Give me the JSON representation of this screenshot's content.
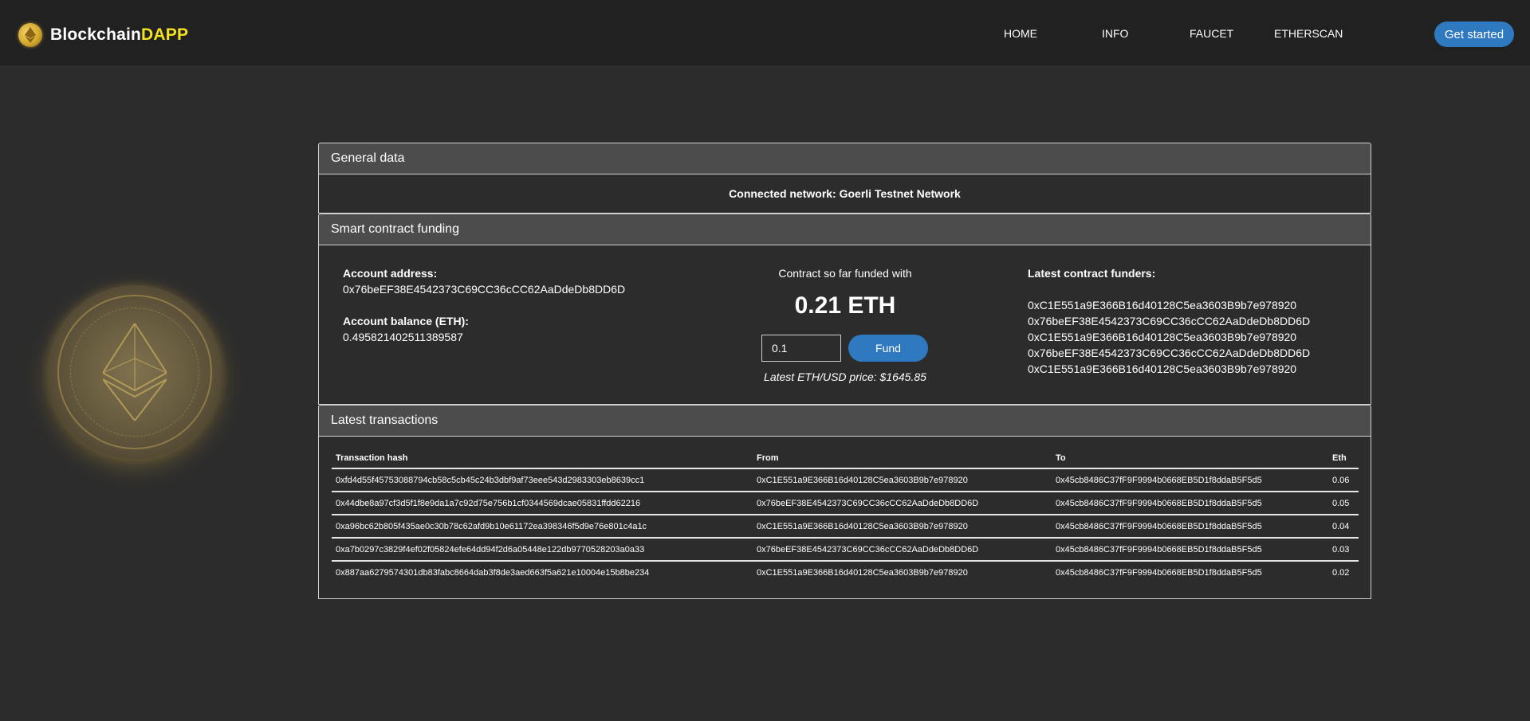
{
  "nav": {
    "brand_part1": "Blockchain",
    "brand_part2": "DAPP",
    "links": [
      "HOME",
      "INFO",
      "FAUCET",
      "ETHERSCAN"
    ],
    "cta": "Get started"
  },
  "general": {
    "title": "General data",
    "network": "Connected network: Goerli Testnet Network"
  },
  "funding": {
    "title": "Smart contract funding",
    "account_address_label": "Account address:",
    "account_address": "0x76beEF38E4542373C69CC36cCC62AaDdeDb8DD6D",
    "account_balance_label": "Account balance (ETH):",
    "account_balance": "0.495821402511389587",
    "funded_label": "Contract so far funded with",
    "funded_amount": "0.21 ETH",
    "input_value": "0.1",
    "fund_button": "Fund",
    "price": "Latest ETH/USD price: $1645.85",
    "funders_label": "Latest contract funders:",
    "funders": [
      "0xC1E551a9E366B16d40128C5ea3603B9b7e978920",
      "0x76beEF38E4542373C69CC36cCC62AaDdeDb8DD6D",
      "0xC1E551a9E366B16d40128C5ea3603B9b7e978920",
      "0x76beEF38E4542373C69CC36cCC62AaDdeDb8DD6D",
      "0xC1E551a9E366B16d40128C5ea3603B9b7e978920"
    ]
  },
  "transactions": {
    "title": "Latest transactions",
    "columns": [
      "Transaction hash",
      "From",
      "To",
      "Eth"
    ],
    "rows": [
      [
        "0xfd4d55f45753088794cb58c5cb45c24b3dbf9af73eee543d2983303eb8639cc1",
        "0xC1E551a9E366B16d40128C5ea3603B9b7e978920",
        "0x45cb8486C37fF9F9994b0668EB5D1f8ddaB5F5d5",
        "0.06"
      ],
      [
        "0x44dbe8a97cf3d5f1f8e9da1a7c92d75e756b1cf0344569dcae05831ffdd62216",
        "0x76beEF38E4542373C69CC36cCC62AaDdeDb8DD6D",
        "0x45cb8486C37fF9F9994b0668EB5D1f8ddaB5F5d5",
        "0.05"
      ],
      [
        "0xa96bc62b805f435ae0c30b78c62afd9b10e61172ea398346f5d9e76e801c4a1c",
        "0xC1E551a9E366B16d40128C5ea3603B9b7e978920",
        "0x45cb8486C37fF9F9994b0668EB5D1f8ddaB5F5d5",
        "0.04"
      ],
      [
        "0xa7b0297c3829f4ef02f05824efe64dd94f2d6a05448e122db9770528203a0a33",
        "0x76beEF38E4542373C69CC36cCC62AaDdeDb8DD6D",
        "0x45cb8486C37fF9F9994b0668EB5D1f8ddaB5F5d5",
        "0.03"
      ],
      [
        "0x887aa6279574301db83fabc8664dab3f8de3aed663f5a621e10004e15b8be234",
        "0xC1E551a9E366B16d40128C5ea3603B9b7e978920",
        "0x45cb8486C37fF9F9994b0668EB5D1f8ddaB5F5d5",
        "0.02"
      ]
    ]
  }
}
